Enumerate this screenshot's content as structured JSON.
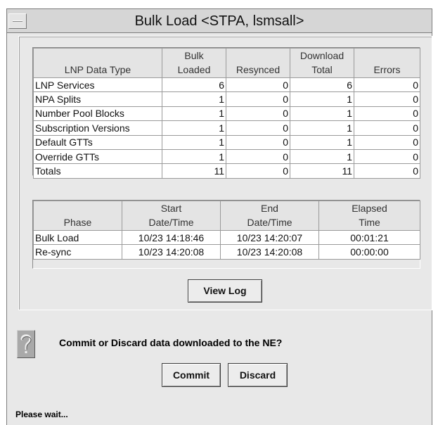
{
  "window": {
    "title": "Bulk Load <STPA, lsmsall>"
  },
  "data_table": {
    "headers": [
      [
        "",
        "LNP Data Type"
      ],
      [
        "Bulk",
        "Loaded"
      ],
      [
        "",
        "Resynced"
      ],
      [
        "Download",
        "Total"
      ],
      [
        "",
        "Errors"
      ]
    ],
    "rows": [
      [
        "LNP Services",
        "6",
        "0",
        "6",
        "0"
      ],
      [
        "NPA Splits",
        "1",
        "0",
        "1",
        "0"
      ],
      [
        "Number Pool Blocks",
        "1",
        "0",
        "1",
        "0"
      ],
      [
        "Subscription Versions",
        "1",
        "0",
        "1",
        "0"
      ],
      [
        "Default GTTs",
        "1",
        "0",
        "1",
        "0"
      ],
      [
        "Override GTTs",
        "1",
        "0",
        "1",
        "0"
      ],
      [
        "Totals",
        "11",
        "0",
        "11",
        "0"
      ]
    ]
  },
  "phase_table": {
    "headers": [
      [
        "",
        "Phase"
      ],
      [
        "Start",
        "Date/Time"
      ],
      [
        "End",
        "Date/Time"
      ],
      [
        "Elapsed",
        "Time"
      ]
    ],
    "rows": [
      [
        "Bulk Load",
        "10/23 14:18:46",
        "10/23 14:20:07",
        "00:01:21"
      ],
      [
        "Re-sync",
        "10/23 14:20:08",
        "10/23 14:20:08",
        "00:00:00"
      ]
    ]
  },
  "buttons": {
    "view_log": "View Log",
    "commit": "Commit",
    "discard": "Discard"
  },
  "prompt": {
    "icon": "question-icon",
    "message": "Commit or Discard data downloaded to the NE?"
  },
  "status": "Please wait..."
}
